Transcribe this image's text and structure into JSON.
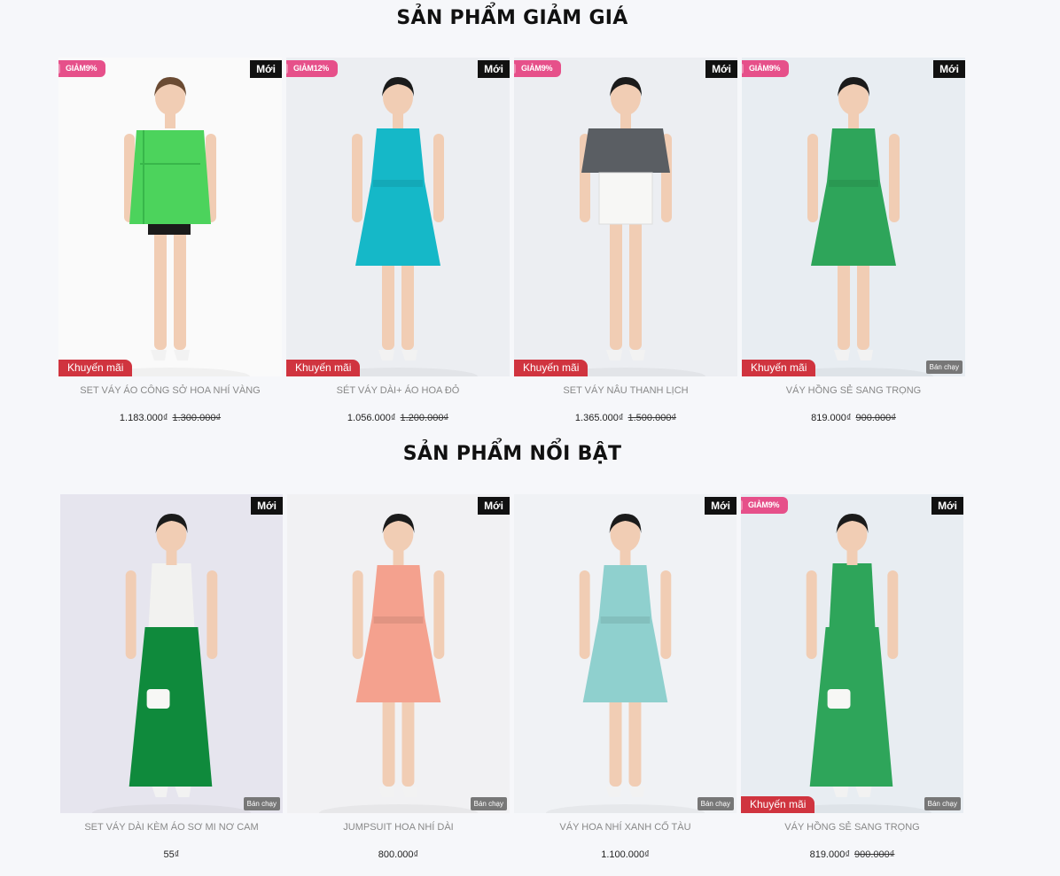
{
  "sections": [
    {
      "title": "SẢN PHẨM GIẢM GIÁ",
      "products": [
        {
          "name": "SET VÁY ÁO CÔNG SỞ HOA NHÍ VÀNG",
          "price": "1.183.000₫",
          "old_price": "1.300.000₫",
          "sale_badge": "GIẢM9%",
          "new_badge": "Mới",
          "promo_badge": "Khuyến mãi",
          "best_badge": "",
          "colors": {
            "bg": "#fafafa",
            "top": "#4cd35c",
            "bottom": "#1b1b1b",
            "hair": "#6b4b33"
          }
        },
        {
          "name": "SÉT VÁY DÀI+ ÁO HOA ĐỎ",
          "price": "1.056.000₫",
          "old_price": "1.200.000₫",
          "sale_badge": "GIẢM12%",
          "new_badge": "Mới",
          "promo_badge": "Khuyến mãi",
          "best_badge": "",
          "colors": {
            "bg": "#eceef2",
            "top": "#15b8c8",
            "bottom": "#15b8c8",
            "hair": "#1b1b1b"
          }
        },
        {
          "name": "SET VÁY NÂU THANH LỊCH",
          "price": "1.365.000₫",
          "old_price": "1.500.000₫",
          "sale_badge": "GIẢM9%",
          "new_badge": "Mới",
          "promo_badge": "Khuyến mãi",
          "best_badge": "",
          "colors": {
            "bg": "#eceef2",
            "top": "#5a5e63",
            "bottom": "#f7f7f5",
            "hair": "#1b1b1b"
          }
        },
        {
          "name": "VÁY HỒNG SẺ SANG TRỌNG",
          "price": "819.000₫",
          "old_price": "900.000₫",
          "sale_badge": "GIẢM9%",
          "new_badge": "Mới",
          "promo_badge": "Khuyến mãi",
          "best_badge": "Bán chạy",
          "colors": {
            "bg": "#e8edf2",
            "top": "#2ea55a",
            "bottom": "#2ea55a",
            "hair": "#1b1b1b"
          }
        }
      ]
    },
    {
      "title": "SẢN PHẨM NỔI BẬT",
      "products": [
        {
          "name": "SET VÁY DÀI KÈM ÁO SƠ MI NƠ CAM",
          "price": "55₫",
          "old_price": "",
          "sale_badge": "",
          "new_badge": "Mới",
          "promo_badge": "",
          "best_badge": "Bán chạy",
          "colors": {
            "bg": "#e6e5ee",
            "top": "#f2f2f0",
            "bottom": "#0f8a3c",
            "hair": "#1b1b1b"
          }
        },
        {
          "name": "JUMPSUIT HOA NHÍ DÀI",
          "price": "800.000₫",
          "old_price": "",
          "sale_badge": "",
          "new_badge": "Mới",
          "promo_badge": "",
          "best_badge": "Bán chạy",
          "colors": {
            "bg": "#f1f1f3",
            "top": "#f4a18e",
            "bottom": "#f4a18e",
            "hair": "#1b1b1b"
          }
        },
        {
          "name": "VÁY HOA NHÍ XANH CỔ TÀU",
          "price": "1.100.000₫",
          "old_price": "",
          "sale_badge": "",
          "new_badge": "Mới",
          "promo_badge": "",
          "best_badge": "Bán chạy",
          "colors": {
            "bg": "#f0f2f5",
            "top": "#8fd0ce",
            "bottom": "#8fd0ce",
            "hair": "#1b1b1b"
          }
        },
        {
          "name": "VÁY HỒNG SẺ SANG TRỌNG",
          "price": "819.000₫",
          "old_price": "900.000₫",
          "sale_badge": "GIẢM9%",
          "new_badge": "Mới",
          "promo_badge": "Khuyến mãi",
          "best_badge": "Bán chạy",
          "colors": {
            "bg": "#e8edf2",
            "top": "#2ea55a",
            "bottom": "#2ea55a",
            "hair": "#1b1b1b"
          }
        }
      ]
    }
  ]
}
